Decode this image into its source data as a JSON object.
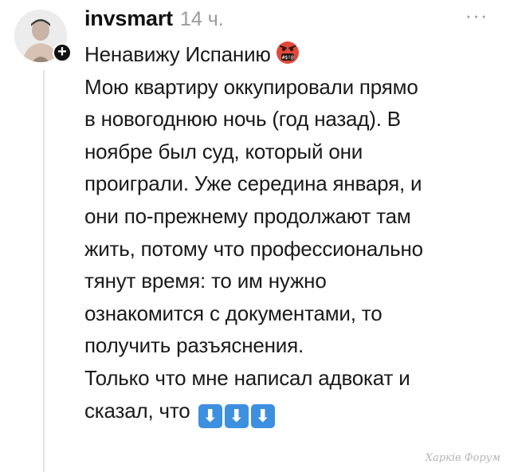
{
  "post": {
    "username": "invsmart",
    "time": "14 ч.",
    "more_label": "···",
    "follow_label": "+",
    "lines": [
      "Ненавижу Испанию",
      "Мою квартиру оккупировали прямо",
      "в новогоднюю ночь (год назад). В",
      "ноябре был суд, который они",
      "проиграли. Уже середина января, и",
      "они по-прежнему продолжают там",
      "жить, потому что профессионально",
      "тянут время: то им нужно",
      "ознакомится с документами, то",
      "получить разъяснения.",
      "Только что мне написал адвокат и",
      "сказал, что"
    ],
    "emoji": {
      "angry_icon": "face-with-symbols-on-mouth-icon",
      "angry_symbols": "#$!@",
      "arrow_icon": "down-arrow-icon",
      "arrow_glyph": "⬇"
    }
  },
  "watermark": "Харків Форум",
  "colors": {
    "text": "#1a1a1a",
    "muted": "#9a9a9a",
    "thread_line": "#e3e3e3",
    "arrow_emoji_bg": "#3d8fe0"
  }
}
